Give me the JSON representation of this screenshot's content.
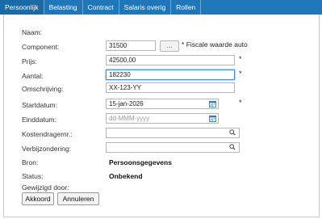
{
  "tabs": [
    "Persoonlijk",
    "Belasting",
    "Contract",
    "Salaris overig",
    "Rollen"
  ],
  "form": {
    "naam_label": "Naam:",
    "component_label": "Component:",
    "component_value": "31500",
    "component_lookup": "...",
    "fiscale_label": "Fiscale waarde auto",
    "prijs_label": "Prijs:",
    "prijs_value": "42500,00",
    "aantal_label": "Aantal:",
    "aantal_value": "182230",
    "omschrijving_label": "Omschrijving:",
    "omschrijving_value": "XX-123-YY",
    "startdatum_label": "Startdatum:",
    "startdatum_value": "15-jan-2026",
    "einddatum_label": "Einddatum:",
    "einddatum_placeholder": "dd-MMM-yyyy",
    "kostendrager_label": "Kostendragernr.:",
    "verbijzondering_label": "Verbijzondering:",
    "bron_label": "Bron:",
    "bron_value": "Persoonsgegevens",
    "status_label": "Status:",
    "status_value": "Onbekend",
    "gewijzigd_label": "Gewijzigd door:",
    "required_mark": "*"
  },
  "buttons": {
    "akkoord": "Akkoord",
    "annuleren": "Annuleren"
  },
  "colors": {
    "tabbar": "#1f76b8",
    "focus": "#4a90d9",
    "calendar": "#2a7ec7"
  }
}
